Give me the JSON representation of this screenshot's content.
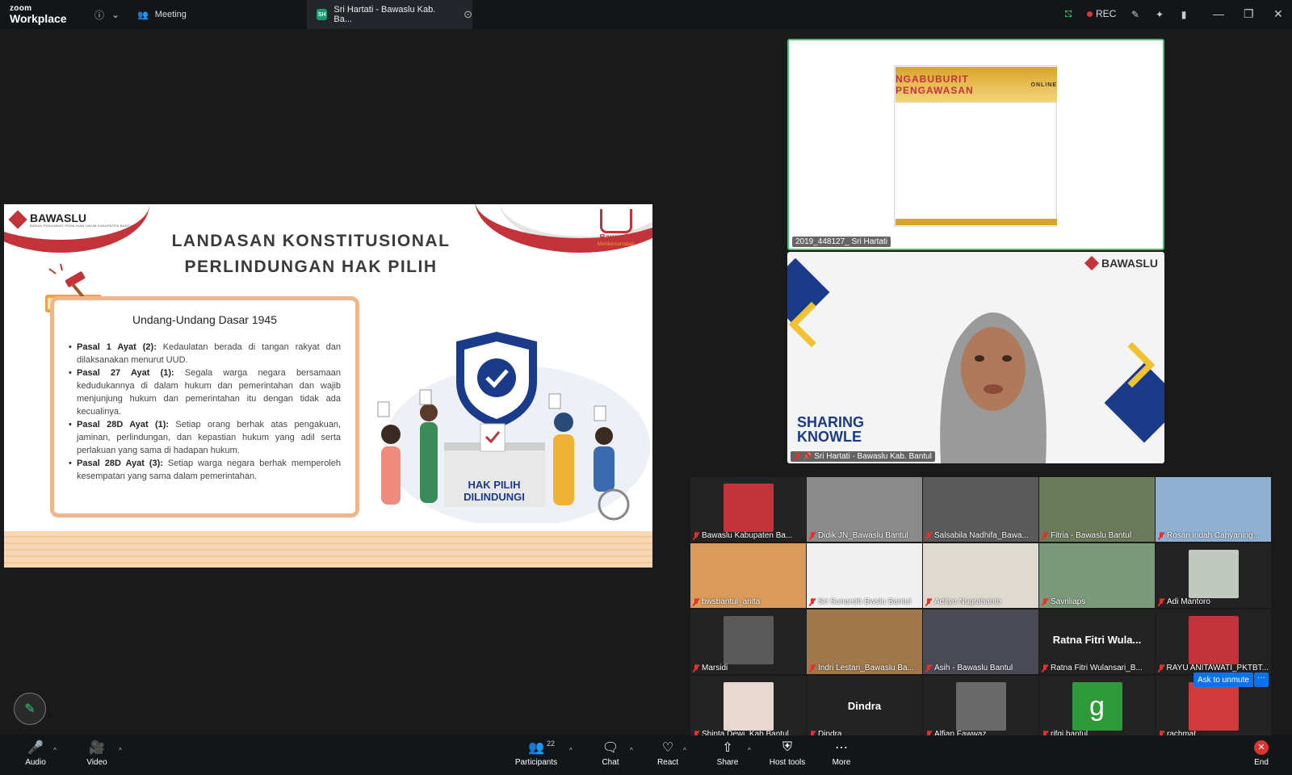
{
  "app": {
    "brand_small": "zoom",
    "brand_name": "Workplace",
    "meeting_tab": "Meeting",
    "share_badge": "SH",
    "share_tab": "Sri Hartati - Bawaslu Kab. Ba...",
    "rec_label": "REC",
    "colors": {
      "accent": "#0e72ed",
      "rec": "#e0322f",
      "active_speaker": "#3cc56f",
      "brand_red": "#c5333a"
    }
  },
  "slide": {
    "logo_text": "BAWASLU",
    "logo_sub": "BADAN PENGAWAS PEMILIHAN UMUM KABUPATEN BANTUL",
    "right_logo": "Bawaslu",
    "right_logo_sub": "Membersamakan",
    "title_line1": "LANDASAN KONSTITUSIONAL",
    "title_line2": "PERLINDUNGAN HAK PILIH",
    "box_title": "Undang-Undang Dasar 1945",
    "items": [
      {
        "bold": "Pasal 1 Ayat (2):",
        "text": " Kedaulatan berada di tangan rakyat dan dilaksanakan menurut UUD."
      },
      {
        "bold": "Pasal 27 Ayat (1):",
        "text": " Segala warga negara bersamaan kedudukannya di dalam hukum dan pemerintahan dan wajib menjunjung hukum dan pemerintahan itu dengan tidak ada kecualinya."
      },
      {
        "bold": "Pasal 28D Ayat (1):",
        "text": " Setiap orang berhak atas pengakuan, jaminan, perlindungan, dan kepastian hukum yang adil serta perlakuan yang sama di hadapan hukum."
      },
      {
        "bold": "Pasal 28D Ayat (3):",
        "text": " Setiap warga negara berhak memperoleh kesempatan yang sama dalam pemerintahan."
      }
    ],
    "ballot_line1": "HAK PILIH",
    "ballot_line2": "DILINDUNGI"
  },
  "speakers": {
    "top": {
      "name": "2019_448127_ Sri Hartati",
      "poster_title": "NGABUBURIT PENGAWASAN",
      "poster_tag": "ONLINE"
    },
    "main": {
      "name": "Sri Hartati - Bawaslu Kab. Bantul",
      "logo_text": "BAWASLU",
      "bg_text_1": "SHARING",
      "bg_text_2": "KNOWLE"
    }
  },
  "gallery": [
    {
      "name": "Bawaslu Kabupaten Ba..."
    },
    {
      "name": "Didik JN_Bawaslu Bantul"
    },
    {
      "name": "Salsabila Nadhifa_Bawa..."
    },
    {
      "name": "Fitria - Bawaslu Bantul"
    },
    {
      "name": "Rosari indah Cahyaning..."
    },
    {
      "name": "bwsbantul_anita"
    },
    {
      "name": "Sri Sunarsih Bwslu Bantul"
    },
    {
      "name": "Adityo Nugrahanto"
    },
    {
      "name": "Savriliaps"
    },
    {
      "name": "Adi Mantoro"
    },
    {
      "name": "Marsidi"
    },
    {
      "name": "Indri Lestari_Bawaslu Ba..."
    },
    {
      "name": "Asih - Bawaslu Bantul"
    },
    {
      "name": "Ratna Fitri Wulansari_B...",
      "display": "Ratna Fitri Wula..."
    },
    {
      "name": "RAYU ANITAWATI_PKTBT..."
    },
    {
      "name": "Shinta Dewi_Kab.Bantul"
    },
    {
      "name": "Dindra",
      "display": "Dindra"
    },
    {
      "name": "Alfian Fawwaz"
    },
    {
      "name": "rifqi.bantul",
      "display": "g"
    },
    {
      "name": "rachmat"
    }
  ],
  "ask_to_unmute": "Ask to unmute",
  "ask_more": "···",
  "toolbar": {
    "audio": "Audio",
    "video": "Video",
    "participants": "Participants",
    "participants_count": "22",
    "chat": "Chat",
    "react": "React",
    "share": "Share",
    "host_tools": "Host tools",
    "more": "More",
    "end": "End"
  }
}
